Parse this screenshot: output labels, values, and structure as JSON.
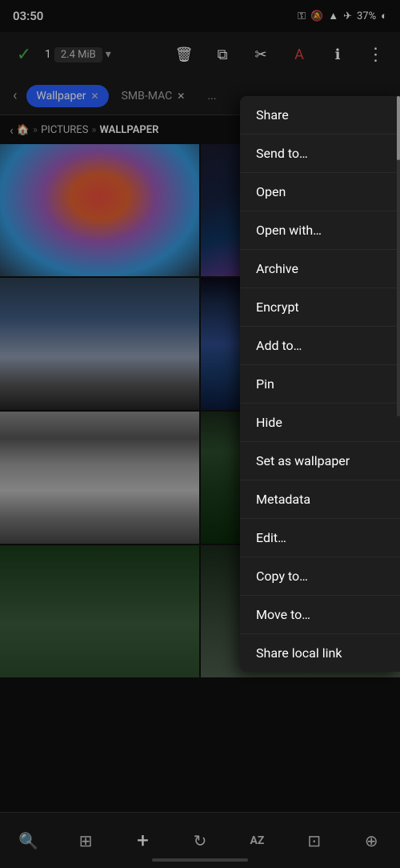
{
  "statusBar": {
    "time": "03:50",
    "battery": "37%"
  },
  "toolbar": {
    "selectedCount": "1",
    "fileSize": "2.4 MiB",
    "dropdownArrow": "▾"
  },
  "tabs": [
    {
      "label": "Wallpaper",
      "active": true
    },
    {
      "label": "SMB-MAC",
      "active": false
    }
  ],
  "breadcrumb": {
    "items": [
      "🏠",
      "PICTURES",
      "WALLPAPER"
    ]
  },
  "contextMenu": {
    "items": [
      "Share",
      "Send to…",
      "Open",
      "Open with…",
      "Archive",
      "Encrypt",
      "Add to…",
      "Pin",
      "Hide",
      "Set as wallpaper",
      "Metadata",
      "Edit…",
      "Copy to…",
      "Move to…",
      "Share local link"
    ]
  },
  "bottomNav": {
    "items": [
      {
        "icon": "🔍",
        "name": "search"
      },
      {
        "icon": "⊞",
        "name": "grid"
      },
      {
        "icon": "+",
        "name": "add"
      },
      {
        "icon": "↻",
        "name": "refresh"
      },
      {
        "icon": "AZ",
        "name": "sort"
      },
      {
        "icon": "⊡",
        "name": "select"
      },
      {
        "icon": "⊕",
        "name": "share-wifi"
      }
    ]
  }
}
